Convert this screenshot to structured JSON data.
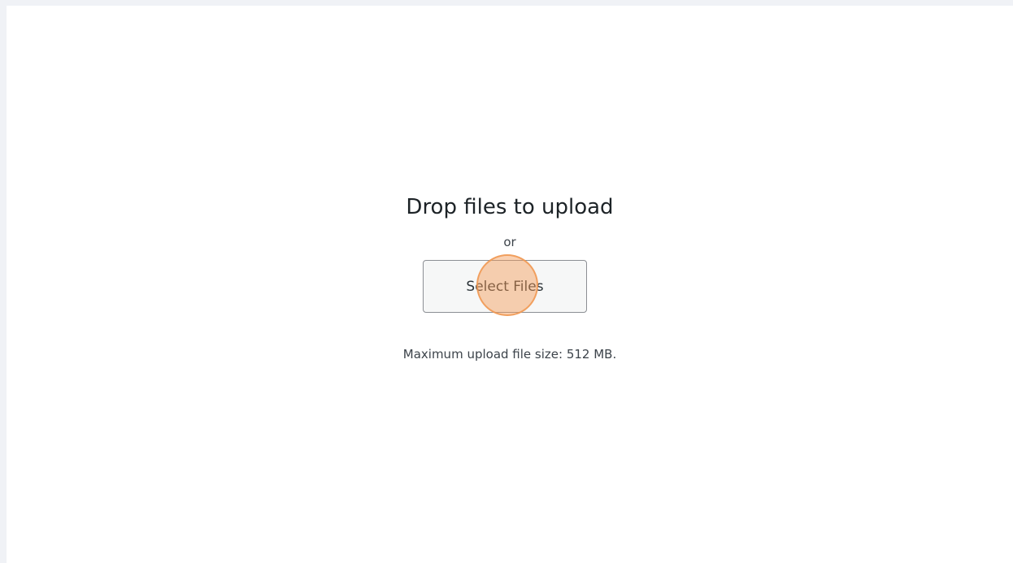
{
  "upload": {
    "title": "Drop files to upload",
    "or_text": "or",
    "select_button_label": "Select Files",
    "max_size_text": "Maximum upload file size: 512 MB."
  },
  "colors": {
    "click_marker": "#f49a54",
    "button_background": "#f6f7f7",
    "button_border": "#8c8f94",
    "page_background": "#ffffff",
    "outer_background": "#f0f2f6"
  }
}
